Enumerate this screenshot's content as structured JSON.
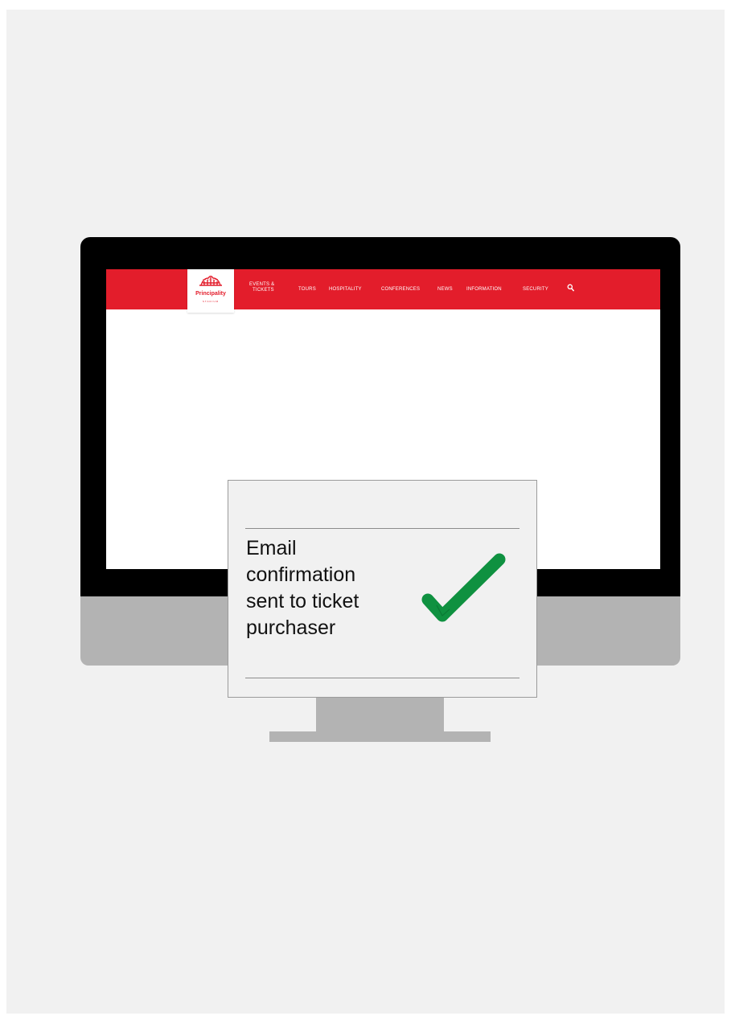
{
  "nav": {
    "logo": {
      "top": "STADIUM",
      "name": "Principality",
      "bottom": "STADIUM"
    },
    "items": [
      "EVENTS &",
      "TICKETS",
      "TOURS",
      "HOSPITALITY",
      "CONFERENCES",
      "NEWS",
      "INFORMATION",
      "SECURITY"
    ]
  },
  "confirmation": {
    "message": "Email\nconfirmation\nsent to ticket\npurchaser"
  },
  "icons": {
    "search": "search-icon",
    "check": "checkmark-icon"
  },
  "colors": {
    "nav": "#e31d2b",
    "check": "#0f9140"
  }
}
